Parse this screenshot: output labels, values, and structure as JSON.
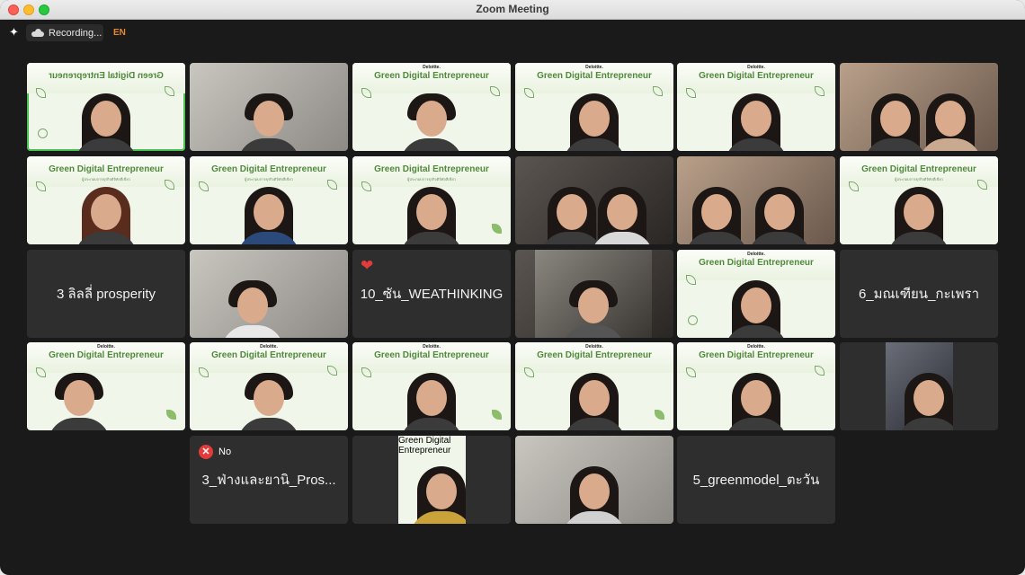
{
  "window": {
    "title": "Zoom Meeting"
  },
  "toolbar": {
    "sparkle_icon": "sparkle-icon",
    "recording_icon": "cloud-icon",
    "recording_label": "Recording...",
    "language_label": "EN"
  },
  "slide": {
    "logo": "Deloitte.",
    "title": "Green Digital Entrepreneur",
    "subtitle": "ผู้ประกอบการธุรกิจดิจิทัลสีเขียว"
  },
  "name_tiles": {
    "t1": "3 ลิลลี่ prosperity",
    "t2": "10_ซัน_WEATHINKING",
    "t3": "6_มณเฑียน_กะเพรา",
    "t4": "3_ฟ่างและยานิ_Pros...",
    "t5": "5_greenmodel_ตะวัน"
  },
  "reactions": {
    "heart": "❤",
    "no_label": "No",
    "no_icon": "✕"
  }
}
